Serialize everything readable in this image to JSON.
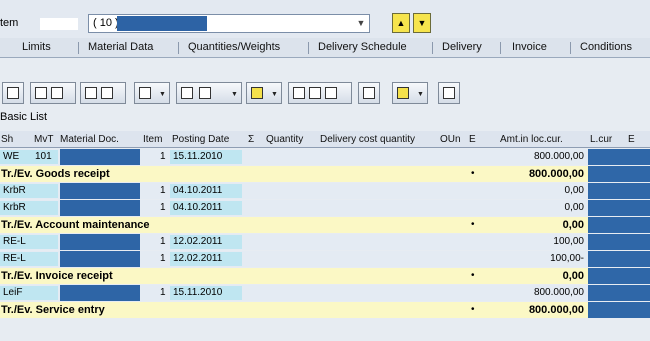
{
  "item_header": {
    "label": "tem",
    "field_value": "( 10 )",
    "dropdown_icon": "▼"
  },
  "nav": {
    "up_label": "▲",
    "down_label": "▼"
  },
  "tabs": [
    "Limits",
    "Material Data",
    "Quantities/Weights",
    "Delivery Schedule",
    "Delivery",
    "Invoice",
    "Conditions"
  ],
  "basic_list": "Basic List",
  "table": {
    "headers": {
      "sh": "Sh",
      "mvt": "MvT",
      "material_doc": "Material Doc.",
      "item": "Item",
      "posting_date": "Posting Date",
      "sigma": "Σ",
      "quantity": "Quantity",
      "delivery_cost_qty": "Delivery cost quantity",
      "oun": "OUn",
      "e": "E",
      "amount": "Amt.in loc.cur.",
      "l_cur": "L.cur",
      "last": "E"
    },
    "rows": [
      {
        "type": "data",
        "sh": "WE",
        "mvt": "101",
        "item": "1",
        "date": "15.11.2010",
        "amount": "800.000,00"
      },
      {
        "type": "sum",
        "label": "Tr./Ev. Goods receipt",
        "marker": "•",
        "amount": "800.000,00"
      },
      {
        "type": "data",
        "sh": "KrbR",
        "mvt": "",
        "item": "1",
        "date": "04.10.2011",
        "amount": "0,00"
      },
      {
        "type": "data",
        "sh": "KrbR",
        "mvt": "",
        "item": "1",
        "date": "04.10.2011",
        "amount": "0,00"
      },
      {
        "type": "sum",
        "label": "Tr./Ev. Account maintenance",
        "marker": "•",
        "amount": "0,00"
      },
      {
        "type": "data",
        "sh": "RE-L",
        "mvt": "",
        "item": "1",
        "date": "12.02.2011",
        "amount": "100,00"
      },
      {
        "type": "data",
        "sh": "RE-L",
        "mvt": "",
        "item": "1",
        "date": "12.02.2011",
        "amount": "100,00-"
      },
      {
        "type": "sum",
        "label": "Tr./Ev. Invoice receipt",
        "marker": "•",
        "amount": "0,00"
      },
      {
        "type": "data",
        "sh": "LeiF",
        "mvt": "",
        "item": "1",
        "date": "15.11.2010",
        "amount": "800.000,00"
      },
      {
        "type": "sum",
        "label": "Tr./Ev. Service entry",
        "marker": "•",
        "amount": "800.000,00"
      }
    ]
  },
  "colors": {
    "accent_blue": "#2e65a6",
    "cyan_cell": "#bfe6f1",
    "sum_row": "#fbf8c5",
    "nav_yellow": "#f6e44d"
  },
  "icons": [
    "print-icon",
    "find-icon",
    "find-next-icon",
    "sort-ascending-icon",
    "sort-descending-icon",
    "filter-icon",
    "sum-icon",
    "subtotal-icon",
    "export-icon",
    "layout-icon",
    "details-icon",
    "select-all-icon",
    "deselect-icon",
    "info-icon",
    "graphics-icon",
    "refresh-icon"
  ]
}
